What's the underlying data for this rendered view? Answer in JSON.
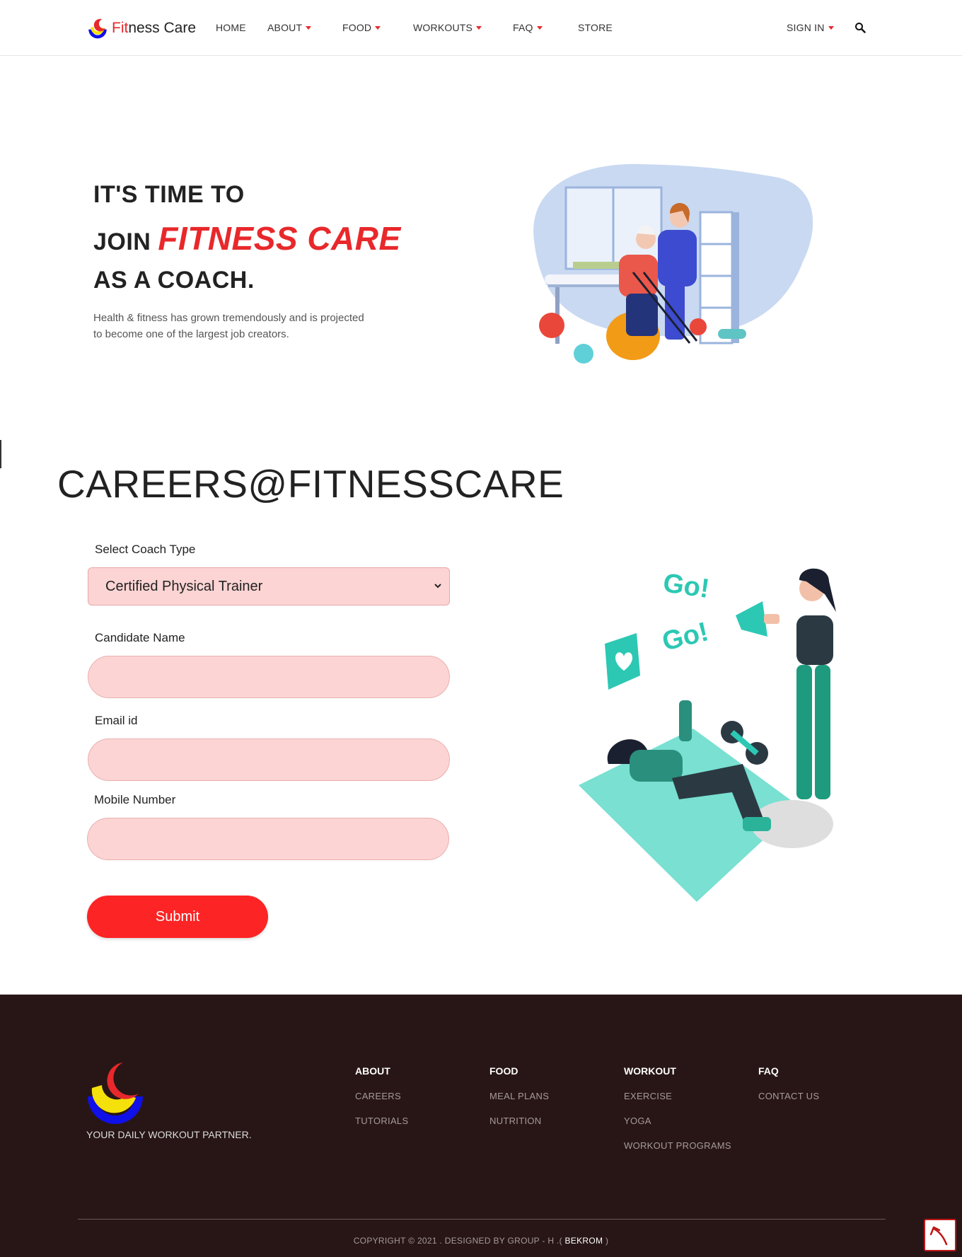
{
  "nav": {
    "brand_first": "Fit",
    "brand_rest": "ness Care",
    "home": "HOME",
    "about": "ABOUT",
    "food": "FOOD",
    "workouts": "WORKOUTS",
    "faq": "FAQ",
    "store": "STORE",
    "sign_in": "SIGN IN"
  },
  "hero": {
    "line1": "IT'S TIME TO",
    "line2_prefix": "JOIN",
    "line2_accent": "FITNESS CARE",
    "line3": "AS A COACH.",
    "desc_line1": "Health & fitness has grown tremendously and is projected",
    "desc_line2": "to become one of the largest job creators."
  },
  "careers": {
    "title": "CAREERS@FITNESSCARE",
    "coach_type_label": "Select Coach Type",
    "coach_type_value": "Certified Physical Trainer",
    "name_label": "Candidate Name",
    "name_value": "",
    "email_label": "Email id",
    "email_value": "",
    "mobile_label": "Mobile Number",
    "mobile_value": "",
    "submit": "Submit"
  },
  "illustration": {
    "go1": "Go!",
    "go2": "Go!"
  },
  "footer": {
    "tagline": "YOUR DAILY WORKOUT PARTNER.",
    "columns": [
      {
        "head": "ABOUT",
        "links": [
          "CAREERS",
          "TUTORIALS"
        ]
      },
      {
        "head": "FOOD",
        "links": [
          "MEAL PLANS",
          "NUTRITION"
        ]
      },
      {
        "head": "WORKOUT",
        "links": [
          "EXERCISE",
          "YOGA",
          "WORKOUT PROGRAMS"
        ]
      },
      {
        "head": "FAQ",
        "links": [
          "CONTACT US"
        ]
      }
    ],
    "copyright_prefix": "COPYRIGHT © 2021 . DESIGNED BY GROUP - H .(",
    "copyright_owner": "BEKROM",
    "copyright_suffix": ")"
  },
  "colors": {
    "accent": "#e8282b",
    "input_bg": "#fcd4d4",
    "submit_bg": "#fc2424",
    "footer_bg": "#281616"
  },
  "icons": [
    "logo-icon",
    "caret-down-icon",
    "search-icon",
    "chevron-down-icon",
    "back-to-top-icon"
  ]
}
